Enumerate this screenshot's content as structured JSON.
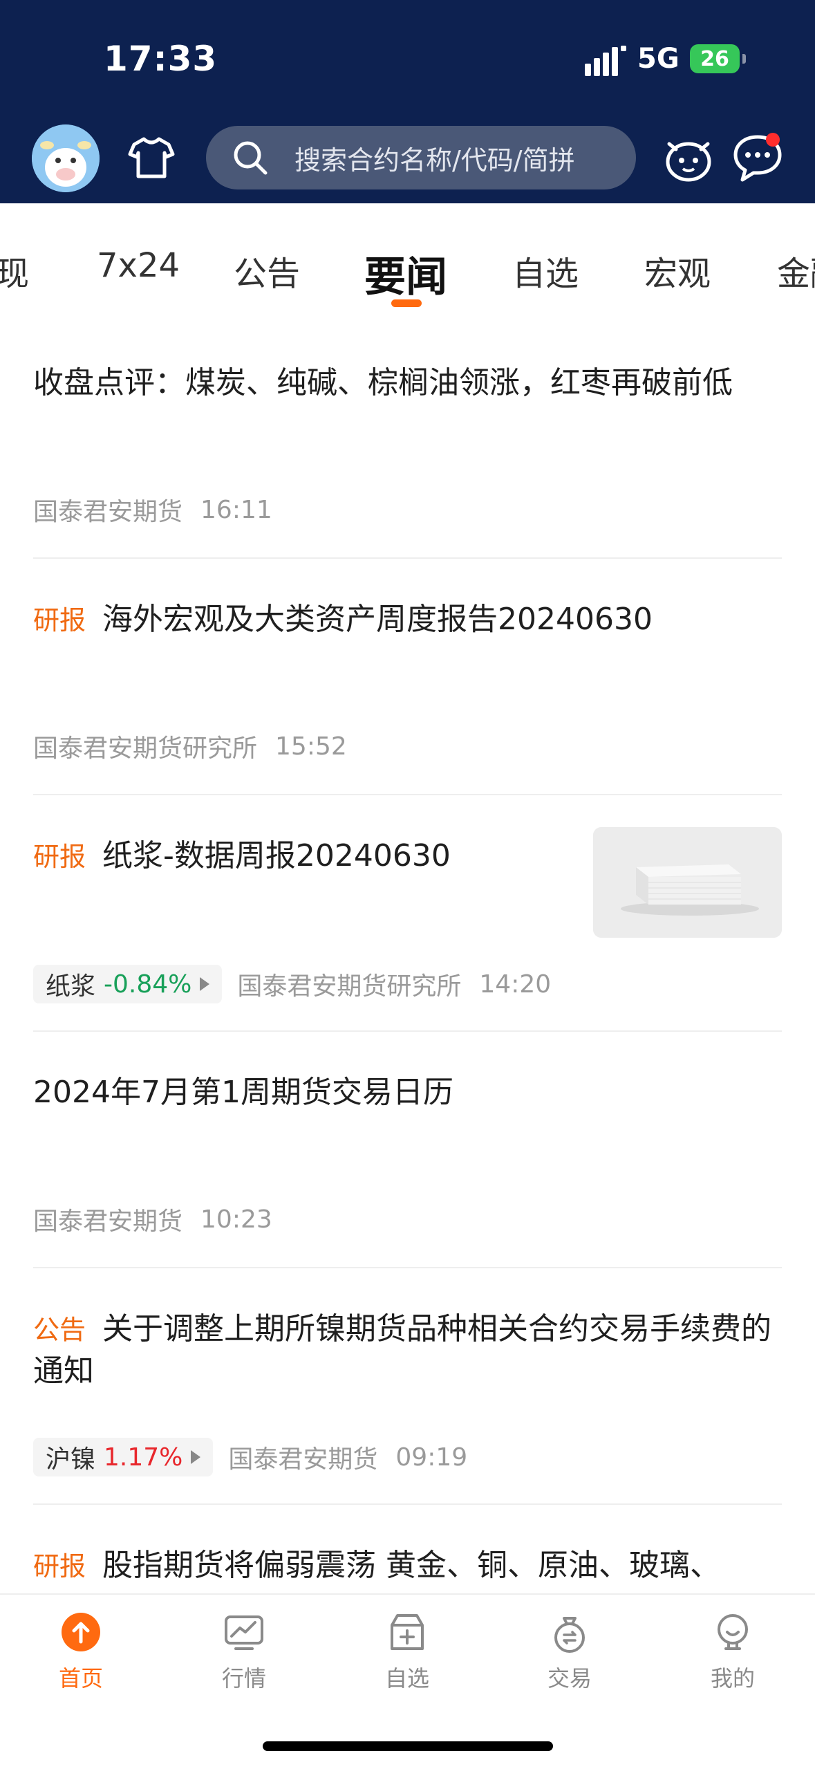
{
  "status_bar": {
    "time": "17:33",
    "network": "5G",
    "battery": "26"
  },
  "header": {
    "search_placeholder": "搜索合约名称/代码/简拼",
    "icons": [
      "avatar",
      "shirt-icon",
      "search-icon",
      "mascot-icon",
      "message-icon"
    ]
  },
  "tabs": [
    {
      "label": "现",
      "active": false
    },
    {
      "label": "7x24",
      "active": false
    },
    {
      "label": "公告",
      "active": false
    },
    {
      "label": "要闻",
      "active": true
    },
    {
      "label": "自选",
      "active": false
    },
    {
      "label": "宏观",
      "active": false
    },
    {
      "label": "金融",
      "active": false
    }
  ],
  "news": [
    {
      "tag": "",
      "title": "收盘点评：煤炭、纯碱、棕榈油领涨，红枣再破前低",
      "source": "国泰君安期货",
      "time": "16:11"
    },
    {
      "tag": "研报",
      "title": "海外宏观及大类资产周度报告20240630",
      "source": "国泰君安期货研究所",
      "time": "15:52"
    },
    {
      "tag": "研报",
      "title": "纸浆-数据周报20240630",
      "source": "国泰君安期货研究所",
      "time": "14:20",
      "chip": {
        "name": "纸浆",
        "change": "-0.84%"
      },
      "has_thumbnail": true
    },
    {
      "tag": "",
      "title": "2024年7月第1周期货交易日历",
      "source": "国泰君安期货",
      "time": "10:23"
    },
    {
      "tag": "公告",
      "title": "关于调整上期所镍期货品种相关合约交易手续费的通知",
      "source": "国泰君安期货",
      "time": "09:19",
      "chip": {
        "name": "沪镍",
        "change": "1.17%"
      }
    },
    {
      "tag": "研报",
      "title": "股指期货将偏弱震荡 黄金、铜、原油、玻璃、"
    }
  ],
  "bottom_nav": [
    {
      "label": "首页",
      "icon": "home-icon",
      "active": true
    },
    {
      "label": "行情",
      "icon": "market-chart-icon",
      "active": false
    },
    {
      "label": "自选",
      "icon": "watchlist-box-icon",
      "active": false
    },
    {
      "label": "交易",
      "icon": "trade-bag-icon",
      "active": false
    },
    {
      "label": "我的",
      "icon": "profile-icon",
      "active": false
    }
  ],
  "colors": {
    "header_bg": "#0d2150",
    "accent": "#ff6a10",
    "down": "#18a059",
    "up": "#e8272c"
  }
}
